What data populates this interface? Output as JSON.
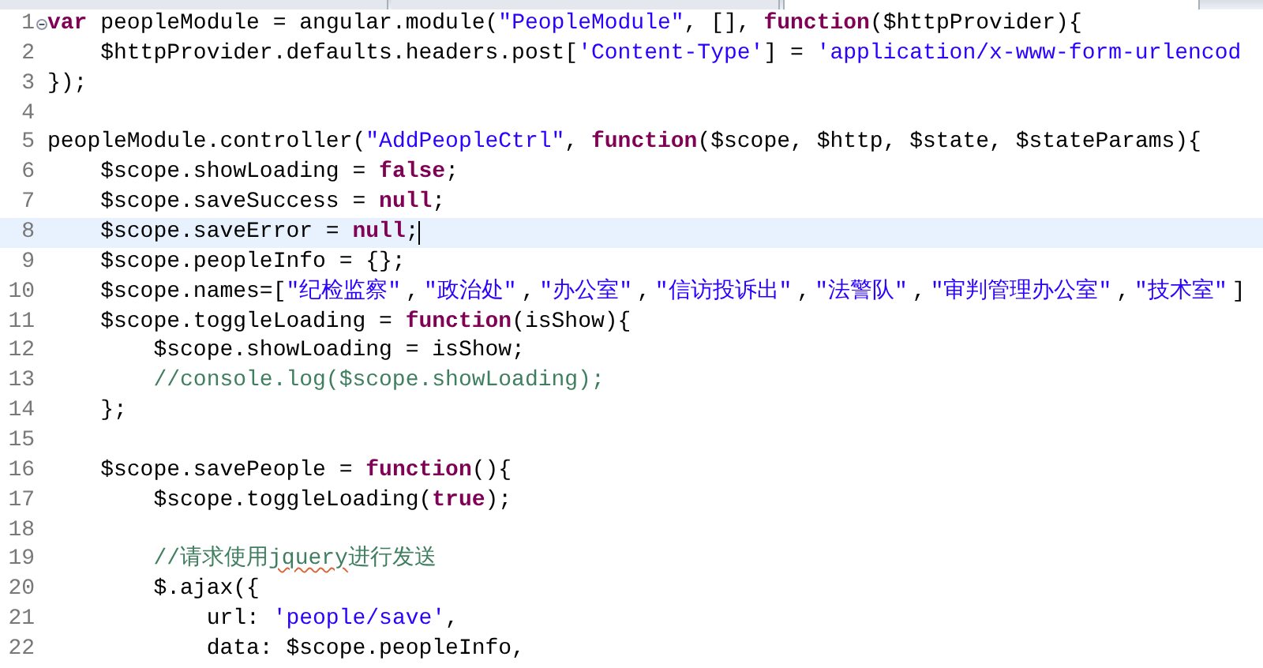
{
  "tabs": [
    {
      "selected": false
    },
    {
      "selected": false
    },
    {
      "selected": true
    }
  ],
  "editor": {
    "lines": [
      {
        "number": "1",
        "fold": true,
        "current": false,
        "tokens": [
          {
            "kind": "keyword",
            "text": "var"
          },
          {
            "kind": "plain",
            "text": " peopleModule = angular.module("
          },
          {
            "kind": "string",
            "text": "\"PeopleModule\""
          },
          {
            "kind": "plain",
            "text": ", [], "
          },
          {
            "kind": "keyword",
            "text": "function"
          },
          {
            "kind": "plain",
            "text": "($httpProvider){"
          }
        ]
      },
      {
        "number": "2",
        "fold": false,
        "current": false,
        "tokens": [
          {
            "kind": "plain",
            "text": "    $httpProvider.defaults.headers.post["
          },
          {
            "kind": "string",
            "text": "'Content-Type'"
          },
          {
            "kind": "plain",
            "text": "] = "
          },
          {
            "kind": "string",
            "text": "'application/x-www-form-urlencod"
          }
        ]
      },
      {
        "number": "3",
        "fold": false,
        "current": false,
        "tokens": [
          {
            "kind": "plain",
            "text": "});"
          }
        ]
      },
      {
        "number": "4",
        "fold": false,
        "current": false
      },
      {
        "number": "5",
        "fold": false,
        "current": false,
        "tokens": [
          {
            "kind": "plain",
            "text": "peopleModule.controller("
          },
          {
            "kind": "string",
            "text": "\"AddPeopleCtrl\""
          },
          {
            "kind": "plain",
            "text": ", "
          },
          {
            "kind": "keyword",
            "text": "function"
          },
          {
            "kind": "plain",
            "text": "($scope, $http, $state, $stateParams){"
          }
        ]
      },
      {
        "number": "6",
        "fold": false,
        "current": false,
        "tokens": [
          {
            "kind": "plain",
            "text": "    $scope.showLoading = "
          },
          {
            "kind": "keyword",
            "text": "false"
          },
          {
            "kind": "plain",
            "text": ";"
          }
        ]
      },
      {
        "number": "7",
        "fold": false,
        "current": false,
        "tokens": [
          {
            "kind": "plain",
            "text": "    $scope.saveSuccess = "
          },
          {
            "kind": "keyword",
            "text": "null"
          },
          {
            "kind": "plain",
            "text": ";"
          }
        ]
      },
      {
        "number": "8",
        "fold": false,
        "current": true,
        "tokens": [
          {
            "kind": "plain",
            "text": "    $scope.saveError = "
          },
          {
            "kind": "keyword",
            "text": "null"
          },
          {
            "kind": "plain",
            "text": ";"
          }
        ]
      },
      {
        "number": "9",
        "fold": false,
        "current": false,
        "tokens": [
          {
            "kind": "plain",
            "text": "    $scope.peopleInfo = {};"
          }
        ]
      },
      {
        "number": "10",
        "fold": false,
        "current": false,
        "tokens": [
          {
            "kind": "plain",
            "text": "    $scope.names=["
          },
          {
            "kind": "string",
            "text": "\"纪检监察\""
          },
          {
            "kind": "plain",
            "text": ","
          },
          {
            "kind": "string",
            "text": "\"政治处\""
          },
          {
            "kind": "plain",
            "text": ","
          },
          {
            "kind": "string",
            "text": "\"办公室\""
          },
          {
            "kind": "plain",
            "text": ","
          },
          {
            "kind": "string",
            "text": "\"信访投诉出\""
          },
          {
            "kind": "plain",
            "text": ","
          },
          {
            "kind": "string",
            "text": "\"法警队\""
          },
          {
            "kind": "plain",
            "text": ","
          },
          {
            "kind": "string",
            "text": "\"审判管理办公室\""
          },
          {
            "kind": "plain",
            "text": ","
          },
          {
            "kind": "string",
            "text": "\"技术室\""
          },
          {
            "kind": "plain",
            "text": "]"
          }
        ]
      },
      {
        "number": "11",
        "fold": false,
        "current": false,
        "tokens": [
          {
            "kind": "plain",
            "text": "    $scope.toggleLoading = "
          },
          {
            "kind": "keyword",
            "text": "function"
          },
          {
            "kind": "plain",
            "text": "(isShow){"
          }
        ]
      },
      {
        "number": "12",
        "fold": false,
        "current": false,
        "tokens": [
          {
            "kind": "plain",
            "text": "        $scope.showLoading = isShow;"
          }
        ]
      },
      {
        "number": "13",
        "fold": false,
        "current": false,
        "tokens": [
          {
            "kind": "comment",
            "text": "        //console.log($scope.showLoading);"
          }
        ]
      },
      {
        "number": "14",
        "fold": false,
        "current": false,
        "tokens": [
          {
            "kind": "plain",
            "text": "    };"
          }
        ]
      },
      {
        "number": "15",
        "fold": false,
        "current": false
      },
      {
        "number": "16",
        "fold": false,
        "current": false,
        "tokens": [
          {
            "kind": "plain",
            "text": "    $scope.savePeople = "
          },
          {
            "kind": "keyword",
            "text": "function"
          },
          {
            "kind": "plain",
            "text": "(){"
          }
        ]
      },
      {
        "number": "17",
        "fold": false,
        "current": false,
        "tokens": [
          {
            "kind": "plain",
            "text": "        $scope.toggleLoading("
          },
          {
            "kind": "keyword",
            "text": "true"
          },
          {
            "kind": "plain",
            "text": ");"
          }
        ]
      },
      {
        "number": "18",
        "fold": false,
        "current": false
      },
      {
        "number": "19",
        "fold": false,
        "current": false,
        "tokens": [
          {
            "kind": "comment",
            "text": "        //请求使用"
          },
          {
            "kind": "comment-misspelled",
            "text": "jquery"
          },
          {
            "kind": "comment",
            "text": "进行发送"
          }
        ]
      },
      {
        "number": "20",
        "fold": false,
        "current": false,
        "tokens": [
          {
            "kind": "plain",
            "text": "        $.ajax({"
          }
        ]
      },
      {
        "number": "21",
        "fold": false,
        "current": false,
        "tokens": [
          {
            "kind": "plain",
            "text": "            url: "
          },
          {
            "kind": "string",
            "text": "'people/save'"
          },
          {
            "kind": "plain",
            "text": ","
          }
        ]
      },
      {
        "number": "22",
        "fold": false,
        "current": false,
        "tokens": [
          {
            "kind": "plain",
            "text": "            data: $scope.peopleInfo,"
          }
        ]
      }
    ]
  }
}
